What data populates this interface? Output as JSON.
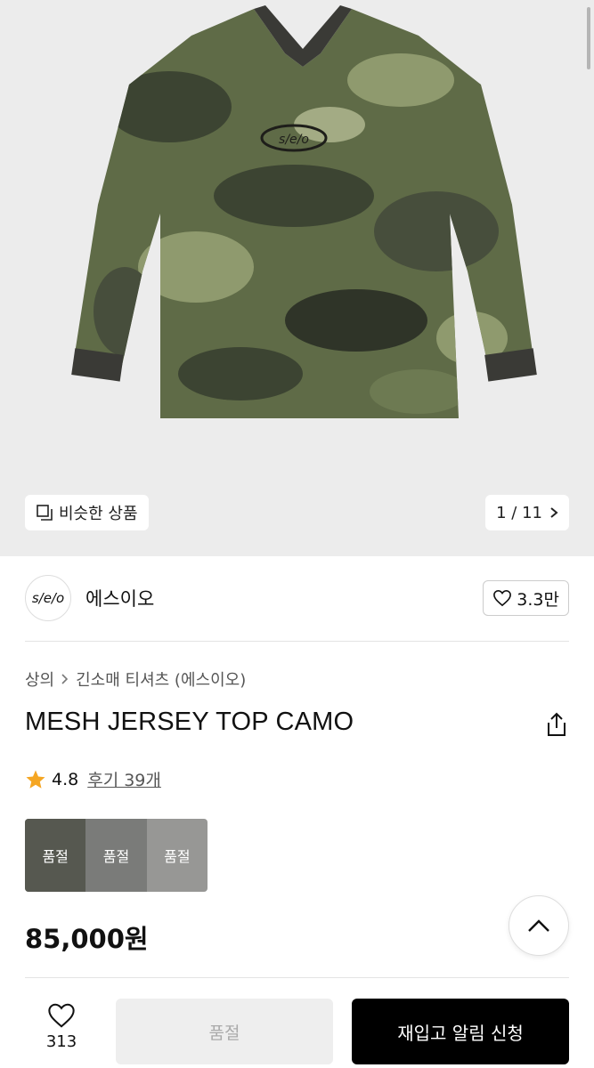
{
  "hero": {
    "similar_label": "비슷한 상품",
    "counter": "1 / 11",
    "shirt_logo": "s/e/o"
  },
  "brand": {
    "logo_text": "s/e/o",
    "name": "에스이오",
    "likes": "3.3만"
  },
  "breadcrumb": {
    "category": "상의",
    "subcategory": "긴소매 티셔츠 (에스이오)"
  },
  "product": {
    "title": "MESH JERSEY TOP CAMO",
    "rating": "4.8",
    "reviews": "후기 39개",
    "price": "85,000원"
  },
  "swatches": [
    {
      "label": "품절"
    },
    {
      "label": "품절"
    },
    {
      "label": "품절"
    }
  ],
  "bottom_bar": {
    "wish_count": "313",
    "soldout_label": "품절",
    "restock_label": "재입고 알림 신청"
  },
  "colors": {
    "accent_star": "#f5a623",
    "primary_button": "#000000",
    "disabled_button": "#eeeeee"
  }
}
